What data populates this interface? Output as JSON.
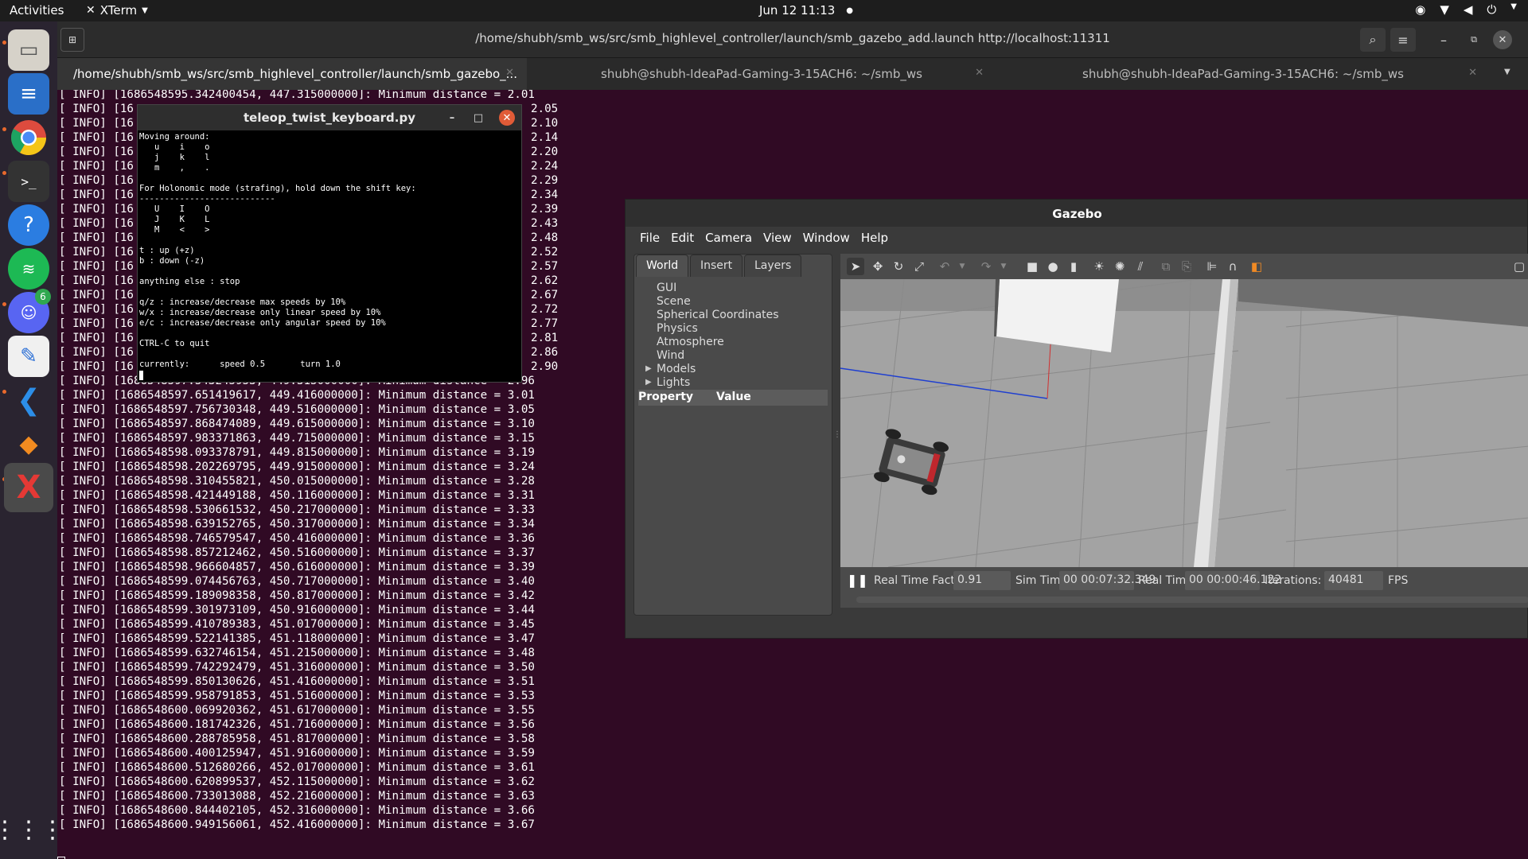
{
  "topbar": {
    "activities": "Activities",
    "app_name": "XTerm",
    "clock": "Jun 12  11:13"
  },
  "terminal": {
    "title": "/home/shubh/smb_ws/src/smb_highlevel_controller/launch/smb_gazebo_add.launch http://localhost:11311",
    "tabs": [
      {
        "label": "/home/shubh/smb_ws/src/smb_highlevel_controller/launch/smb_gazebo_..."
      },
      {
        "label": "shubh@shubh-IdeaPad-Gaming-3-15ACH6: ~/smb_ws"
      },
      {
        "label": "shubh@shubh-IdeaPad-Gaming-3-15ACH6: ~/smb_ws"
      }
    ],
    "lines": [
      "[ INFO] [1686548595.342400454, 447.315000000]: Minimum distance = 2.01",
      "[ INFO] [16",
      "[ INFO] [16",
      "[ INFO] [16",
      "[ INFO] [16",
      "[ INFO] [16",
      "[ INFO] [16",
      "[ INFO] [16",
      "[ INFO] [16",
      "[ INFO] [16",
      "[ INFO] [16",
      "[ INFO] [16",
      "[ INFO] [16",
      "[ INFO] [16",
      "[ INFO] [16",
      "[ INFO] [16",
      "[ INFO] [16",
      "[ INFO] [16",
      "[ INFO] [16",
      "[ INFO] [16",
      "[ INFO] [1686548597.543245953, 449.315000000]: Minimum distance = 2.96",
      "[ INFO] [1686548597.651419617, 449.416000000]: Minimum distance = 3.01",
      "[ INFO] [1686548597.756730348, 449.516000000]: Minimum distance = 3.05",
      "[ INFO] [1686548597.868474089, 449.615000000]: Minimum distance = 3.10",
      "[ INFO] [1686548597.983371863, 449.715000000]: Minimum distance = 3.15",
      "[ INFO] [1686548598.093378791, 449.815000000]: Minimum distance = 3.19",
      "[ INFO] [1686548598.202269795, 449.915000000]: Minimum distance = 3.24",
      "[ INFO] [1686548598.310455821, 450.015000000]: Minimum distance = 3.28",
      "[ INFO] [1686548598.421449188, 450.116000000]: Minimum distance = 3.31",
      "[ INFO] [1686548598.530661532, 450.217000000]: Minimum distance = 3.33",
      "[ INFO] [1686548598.639152765, 450.317000000]: Minimum distance = 3.34",
      "[ INFO] [1686548598.746579547, 450.416000000]: Minimum distance = 3.36",
      "[ INFO] [1686548598.857212462, 450.516000000]: Minimum distance = 3.37",
      "[ INFO] [1686548598.966604857, 450.616000000]: Minimum distance = 3.39",
      "[ INFO] [1686548599.074456763, 450.717000000]: Minimum distance = 3.40",
      "[ INFO] [1686548599.189098358, 450.817000000]: Minimum distance = 3.42",
      "[ INFO] [1686548599.301973109, 450.916000000]: Minimum distance = 3.44",
      "[ INFO] [1686548599.410789383, 451.017000000]: Minimum distance = 3.45",
      "[ INFO] [1686548599.522141385, 451.118000000]: Minimum distance = 3.47",
      "[ INFO] [1686548599.632746154, 451.215000000]: Minimum distance = 3.48",
      "[ INFO] [1686548599.742292479, 451.316000000]: Minimum distance = 3.50",
      "[ INFO] [1686548599.850130626, 451.416000000]: Minimum distance = 3.51",
      "[ INFO] [1686548599.958791853, 451.516000000]: Minimum distance = 3.53",
      "[ INFO] [1686548600.069920362, 451.617000000]: Minimum distance = 3.55",
      "[ INFO] [1686548600.181742326, 451.716000000]: Minimum distance = 3.56",
      "[ INFO] [1686548600.288785958, 451.817000000]: Minimum distance = 3.58",
      "[ INFO] [1686548600.400125947, 451.916000000]: Minimum distance = 3.59",
      "[ INFO] [1686548600.512680266, 452.017000000]: Minimum distance = 3.61",
      "[ INFO] [1686548600.620899537, 452.115000000]: Minimum distance = 3.62",
      "[ INFO] [1686548600.733013088, 452.216000000]: Minimum distance = 3.63",
      "[ INFO] [1686548600.844402105, 452.316000000]: Minimum distance = 3.66",
      "[ INFO] [1686548600.949156061, 452.416000000]: Minimum distance = 3.67"
    ],
    "right_values": [
      "2.05",
      "2.10",
      "2.14",
      "2.20",
      "2.24",
      "2.29",
      "2.34",
      "2.39",
      "2.43",
      "2.48",
      "2.52",
      "2.57",
      "2.62",
      "2.67",
      "2.72",
      "2.77",
      "2.81",
      "2.86",
      "2.90"
    ]
  },
  "teleop": {
    "title": "teleop_twist_keyboard.py",
    "text": "Moving around:\n   u    i    o\n   j    k    l\n   m    ,    .\n\nFor Holonomic mode (strafing), hold down the shift key:\n---------------------------\n   U    I    O\n   J    K    L\n   M    <    >\n\nt : up (+z)\nb : down (-z)\n\nanything else : stop\n\nq/z : increase/decrease max speeds by 10%\nw/x : increase/decrease only linear speed by 10%\ne/c : increase/decrease only angular speed by 10%\n\nCTRL-C to quit\n\ncurrently:      speed 0.5       turn 1.0"
  },
  "gazebo": {
    "title": "Gazebo",
    "menu": [
      "File",
      "Edit",
      "Camera",
      "View",
      "Window",
      "Help"
    ],
    "tabs": [
      "World",
      "Insert",
      "Layers"
    ],
    "tree": [
      "GUI",
      "Scene",
      "Spherical Coordinates",
      "Physics",
      "Atmosphere",
      "Wind",
      "Models",
      "Lights"
    ],
    "prop_header": {
      "property": "Property",
      "value": "Value"
    },
    "stats": {
      "rtf_label": "Real Time Factor:",
      "rtf": "0.91",
      "sim_label": "Sim Time:",
      "sim": "00 00:07:32.349",
      "real_label": "Real Time:",
      "real": "00 00:00:46.122",
      "iter_label": "Iterations:",
      "iter": "40481",
      "fps_label": "FPS"
    }
  },
  "dock": {
    "badge": "6"
  }
}
